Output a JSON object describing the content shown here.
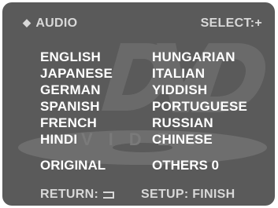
{
  "header": {
    "title": "AUDIO",
    "select_hint": "SELECT:+"
  },
  "languages": {
    "left": [
      "ENGLISH",
      "JAPANESE",
      "GERMAN",
      "SPANISH",
      "FRENCH",
      "HINDI"
    ],
    "right": [
      "HUNGARIAN",
      "ITALIAN",
      "YIDDISH",
      "PORTUGUESE",
      "RUSSIAN",
      "CHINESE"
    ]
  },
  "options": {
    "original": "ORIGINAL",
    "others": "OTHERS 0"
  },
  "footer": {
    "return_label": "RETURN:",
    "setup_label": "SETUP: FINISH"
  },
  "watermark": {
    "text": "VIDEO"
  },
  "colors": {
    "background": "#5a5a5a",
    "text": "#ffffff",
    "watermark": "#6b6b6b"
  }
}
